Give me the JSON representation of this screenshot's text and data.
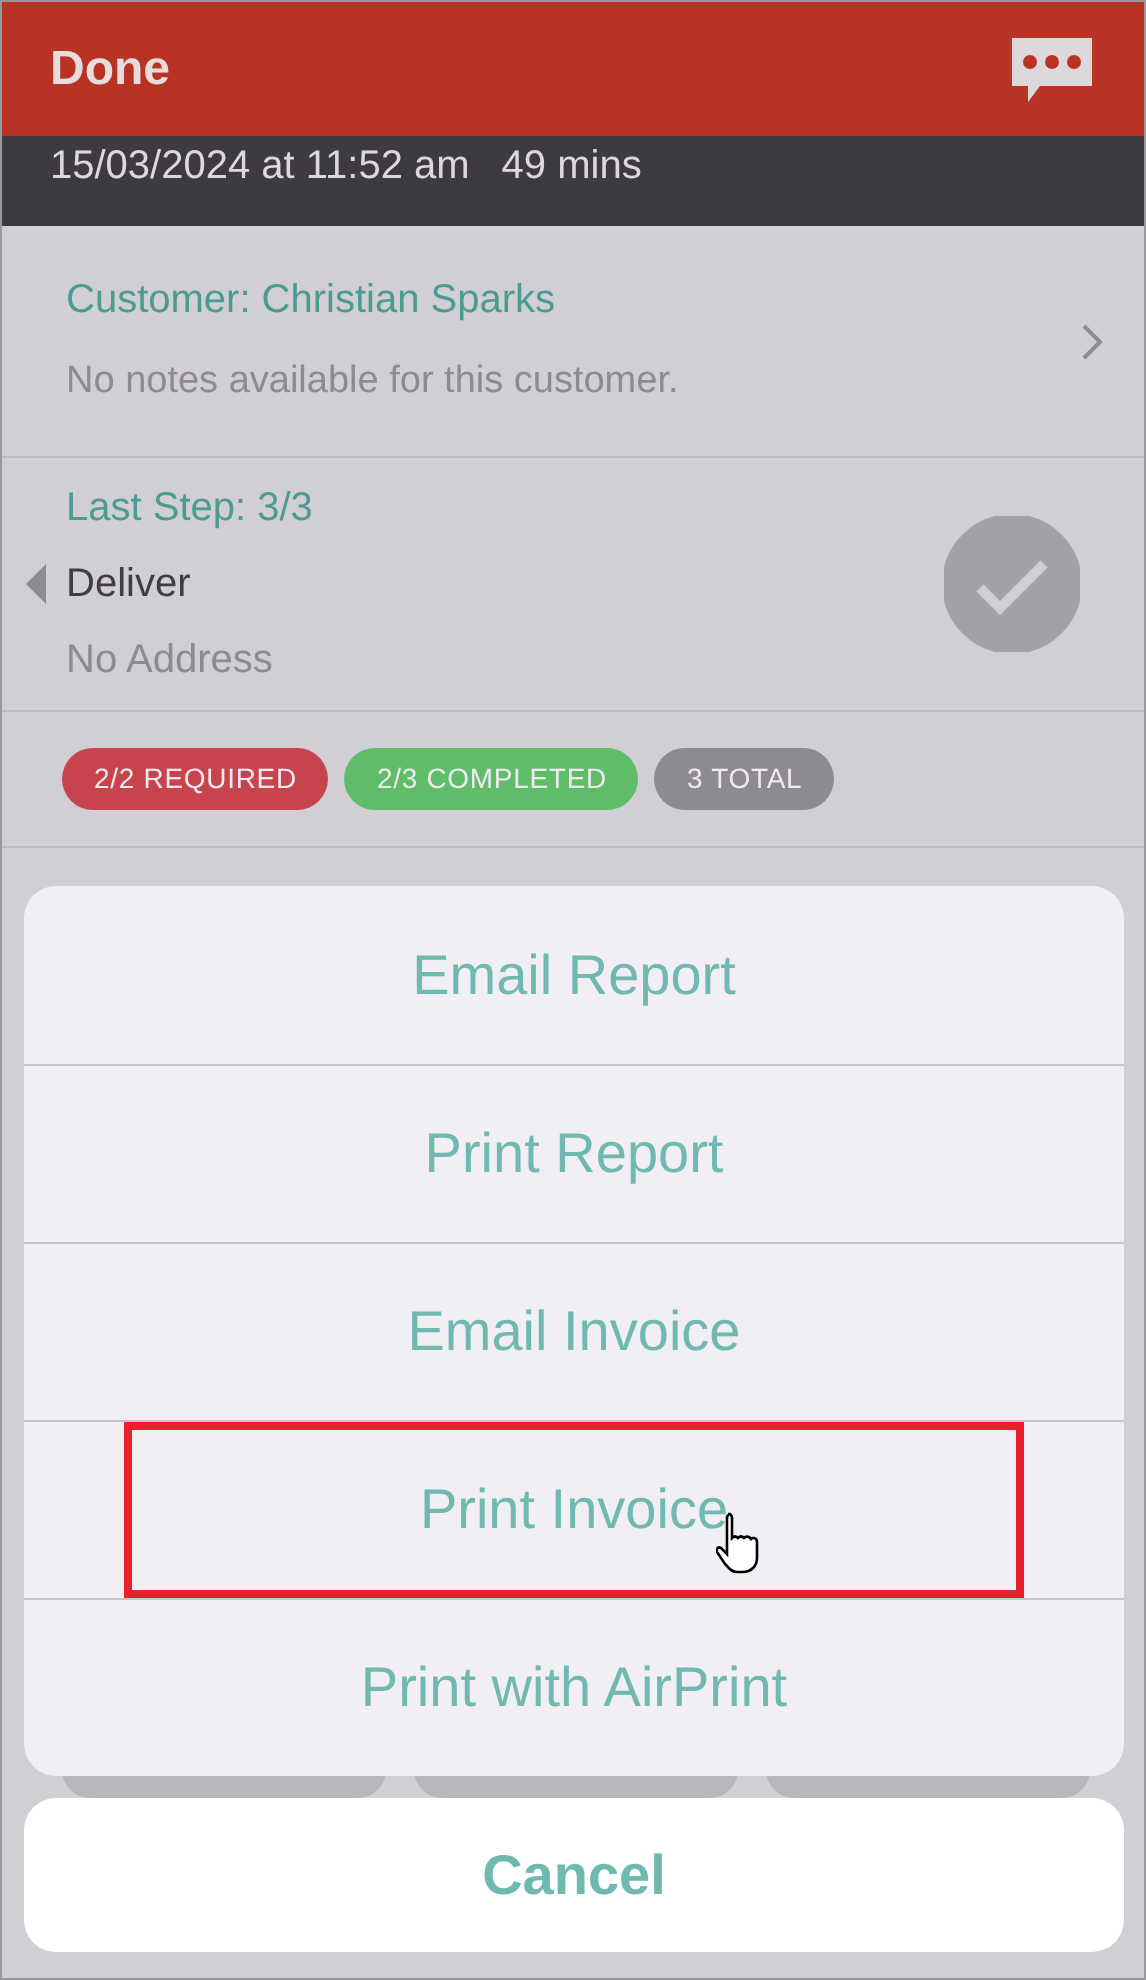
{
  "header": {
    "title": "Done"
  },
  "job": {
    "date": "15/03/2024 at 11:52 am",
    "duration": "49 mins"
  },
  "customer": {
    "title": "Customer: Christian Sparks",
    "notes": "No notes available for this customer."
  },
  "step": {
    "title": "Last Step: 3/3",
    "name": "Deliver",
    "address": "No Address",
    "completed": true
  },
  "badges": [
    {
      "label": "2/2 REQUIRED",
      "color": "#c8444c"
    },
    {
      "label": "2/3 COMPLETED",
      "color": "#5fbd6a"
    },
    {
      "label": "3 TOTAL",
      "color": "#8e8b90"
    }
  ],
  "action_sheet": {
    "items": [
      {
        "label": "Email Report",
        "highlighted": false
      },
      {
        "label": "Print Report",
        "highlighted": false
      },
      {
        "label": "Email Invoice",
        "highlighted": false
      },
      {
        "label": "Print Invoice",
        "highlighted": true
      },
      {
        "label": "Print with AirPrint",
        "highlighted": false
      }
    ],
    "cancel": "Cancel"
  }
}
